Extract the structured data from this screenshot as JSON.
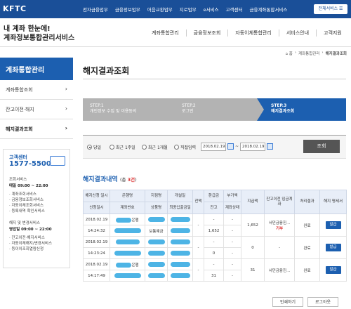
{
  "top": {
    "logo": "KFTC",
    "nav": [
      "전자금융업무",
      "금융정보업무",
      "어음교환업무",
      "지로업무",
      "e서비스",
      "고객센터",
      "금융계좌통합서비스"
    ],
    "all_services": "전체서비스 ☰"
  },
  "brand": {
    "line1": "내 계좌 한눈에!",
    "line2": "계좌정보통합관리서비스"
  },
  "main_nav": [
    "계좌통합관리",
    "금융정보조회",
    "자동이체통합관리",
    "서비스안내",
    "고객지원"
  ],
  "breadcrumb": [
    "⌂ 홈",
    "계좌통합관리",
    "해지결과조회"
  ],
  "sidebar": {
    "title": "계좌통합관리",
    "items": [
      {
        "label": "계좌통합조회"
      },
      {
        "label": "잔고이전·해지"
      },
      {
        "label": "해지결과조회"
      }
    ]
  },
  "callcenter": {
    "title": "고객센터",
    "number": "1577-5500",
    "section1_title": "조회서비스",
    "section1_hours": "매일 09:00 ~ 22:00",
    "section1_items": [
      "계좌조회서비스",
      "금융정보조회서비스",
      "자동이체조회서비스",
      "등록내역 확인서비스"
    ],
    "section2_title": "해지 및 변경서비스",
    "section2_hours": "영업일 09:00 ~ 22:00",
    "section2_items": [
      "잔고이전·해지서비스",
      "자동이체해지/변경서비스",
      "등이이조회열람신청"
    ]
  },
  "page": {
    "title": "해지결과조회"
  },
  "steps": [
    {
      "num": "STEP.1",
      "label": "개인정보 수집 및 이용동의"
    },
    {
      "num": "STEP.2",
      "label": "로그인"
    },
    {
      "num": "STEP.3",
      "label": "해지결과조회"
    }
  ],
  "filter": {
    "options": [
      "당일",
      "최근 1주일",
      "최근 1개월",
      "직접입력"
    ],
    "selected": "당일",
    "date_from": "2018.02.19",
    "date_to": "2018.02.19",
    "search_label": "조회"
  },
  "results": {
    "title": "해지결과내역",
    "count_prefix": "(총 ",
    "count": "3건",
    "count_suffix": ")",
    "headers": {
      "date": "해지신청 일시",
      "date_sub": "신청일시",
      "bank": "은행명",
      "bank_sub": "계좌번호",
      "type": "지점명",
      "type_sub": "상품명",
      "open": "개설일",
      "open_sub": "최종입출금일",
      "acct": "잔액",
      "acct_sub": "",
      "fee": "환급금",
      "fee_sub": "잔고",
      "charge": "부가액",
      "charge_sub": "계좌상태",
      "amount": "지급액",
      "dest": "잔고이전 입금계좌",
      "result": "처리결과",
      "cert": "해지 명세서"
    },
    "rows": [
      {
        "date": "2018.02.19",
        "time": "14:24:32",
        "bank_suffix": "은행",
        "product": "보통예금",
        "dash1": "-",
        "dash2": "-",
        "bal1": "-",
        "bal2": "1,652",
        "fee1": "-",
        "fee2": "-",
        "amount": "1,652",
        "dest": "서민금융진...",
        "dest_note": "기부",
        "result": "완료",
        "issue": "발급"
      },
      {
        "date": "2018.02.19",
        "time": "14:23:24",
        "bank_suffix": "은행",
        "product": "",
        "dash1": "-",
        "dash2": "-",
        "bal1": "-",
        "bal2": "0",
        "fee1": "-",
        "fee2": "-",
        "amount": "0",
        "dest": "-",
        "dest_note": "",
        "result": "완료",
        "issue": "발급"
      },
      {
        "date": "2018.02.19",
        "time": "14:17:49",
        "bank_suffix": "은행",
        "product": "",
        "dash1": "-",
        "dash2": "-",
        "bal1": "-",
        "bal2": "31",
        "fee1": "-",
        "fee2": "-",
        "amount": "31",
        "dest": "서민금융진...",
        "dest_note": "",
        "result": "완료",
        "issue": "발급"
      }
    ]
  },
  "buttons": {
    "print": "인쇄하기",
    "logout": "로그아웃"
  },
  "colors": {
    "primary": "#1c5fb0",
    "topbar": "#1a4f98",
    "step_inactive": "#b3b3b3",
    "highlight": "#d33"
  }
}
